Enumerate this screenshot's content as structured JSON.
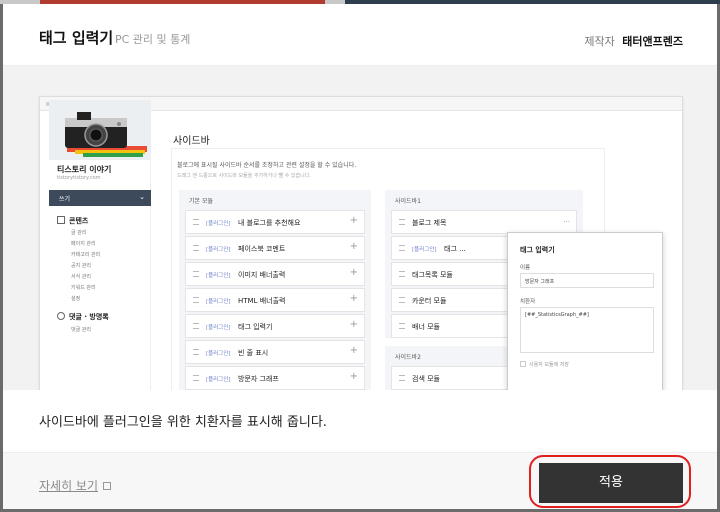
{
  "modal": {
    "title": "태그 입력기",
    "subtitle": "PC 관리 및 통계",
    "maker_label": "제작자",
    "maker_name": "태터앤프렌즈"
  },
  "preview": {
    "blog": {
      "name": "티스토리 이야기",
      "url": "tistorytistory.com",
      "write_label": "쓰기"
    },
    "nav": [
      {
        "label": "콘텐츠",
        "subs": [
          "글 관리",
          "페이지 관리",
          "카테고리 관리",
          "공지 관리",
          "서식 관리",
          "키워드 관리",
          "설정"
        ]
      },
      {
        "label": "댓글 · 방명록",
        "subs": [
          "댓글 관리"
        ]
      }
    ],
    "page_title": "사이드바",
    "desc1": "블로그에 표시될 사이드바 순서를 조정하고 관련 설정을 할 수 있습니다.",
    "desc2": "드래그 앤 드롭으로 사이드바 모듈을 추가하거나 뺄 수 있습니다.",
    "basic_header": "기본 모듈",
    "plugin_tag": "[플러그인]",
    "basic_items": [
      "내 블로그를 추천해요",
      "페이스북 코멘트",
      "이미지 배너출력",
      "HTML 배너출력",
      "태그 입력기",
      "빈 줄 표시",
      "방문자 그래프"
    ],
    "sidebar1_header": "사이드바1",
    "sidebar1_items": [
      {
        "tag": "",
        "name": "블로그 제목"
      },
      {
        "tag": "[플러그인]",
        "name": "태그 ..."
      },
      {
        "tag": "",
        "name": "태그목록 모듈"
      },
      {
        "tag": "",
        "name": "카운터 모듈"
      },
      {
        "tag": "",
        "name": "배너 모듈"
      }
    ],
    "sidebar2_header": "사이드바2",
    "sidebar2_items": [
      "검색 모듈"
    ],
    "popup": {
      "title": "태그 입력기",
      "name_label": "이름",
      "name_value": "방문자 그래프",
      "sub_label": "치환자",
      "sub_value": "[##_StatisticsGraph_##]",
      "check_label": "사용자 모듈에 저장"
    }
  },
  "description": "사이드바에 플러그인을 위한 치환자를 표시해 줍니다.",
  "footer": {
    "more_label": "자세히 보기",
    "apply_label": "적용"
  },
  "colors": {
    "plugin_tag": "#6f83c9",
    "apply_button": "#333333",
    "highlight": "#e01f1f"
  }
}
